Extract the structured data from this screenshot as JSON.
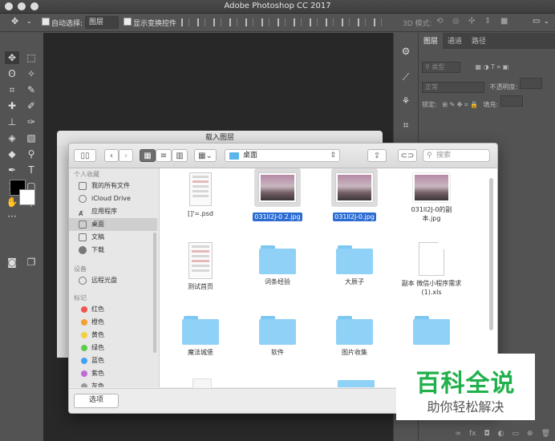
{
  "window": {
    "title": "Adobe Photoshop CC 2017"
  },
  "options_bar": {
    "auto_select_label": "自动选择:",
    "auto_select_value": "图层",
    "show_transform_label": "显示变换控件",
    "mode_3d_label": "3D 模式:"
  },
  "layers_panel": {
    "tabs": [
      "图层",
      "通道",
      "路径"
    ],
    "filter_placeholder": "类型",
    "blend_mode": "正常",
    "opacity_label": "不透明度:",
    "lock_label": "锁定:",
    "fill_label": "填充:"
  },
  "load_layers_window": {
    "title": "载入图层"
  },
  "file_dialog": {
    "location": "桌面",
    "search_placeholder": "搜索",
    "sidebar": {
      "favorites_title": "个人收藏",
      "favorites": [
        "我的所有文件",
        "iCloud Drive",
        "应用程序",
        "桌面",
        "文稿",
        "下载"
      ],
      "devices_title": "设备",
      "devices": [
        "远程光盘"
      ],
      "tags_title": "标记",
      "tags": [
        {
          "label": "红色",
          "color": "#f25450"
        },
        {
          "label": "橙色",
          "color": "#f5a031"
        },
        {
          "label": "黄色",
          "color": "#f4d03e"
        },
        {
          "label": "绿色",
          "color": "#5ccb4d"
        },
        {
          "label": "蓝色",
          "color": "#3fa3f5"
        },
        {
          "label": "紫色",
          "color": "#c06cd8"
        },
        {
          "label": "灰色",
          "color": "#9a9a9a"
        }
      ]
    },
    "files": [
      {
        "label": "[]'=.psd",
        "kind": "psd",
        "selected": false
      },
      {
        "label": "031ll2J-0 2.jpg",
        "kind": "photo",
        "selected": true
      },
      {
        "label": "031ll2J-0.jpg",
        "kind": "photo",
        "selected": true
      },
      {
        "label": "031ll2J-0的副本.jpg",
        "kind": "photo",
        "selected": false
      },
      {
        "label": "测试首页",
        "kind": "image",
        "selected": false
      },
      {
        "label": "词条经验",
        "kind": "folder",
        "selected": false
      },
      {
        "label": "大辰子",
        "kind": "folder",
        "selected": false
      },
      {
        "label": "副本 微信小程序需求(1).xls",
        "kind": "xls",
        "selected": false
      },
      {
        "label": "魔法城堡",
        "kind": "folder",
        "selected": false
      },
      {
        "label": "软件",
        "kind": "folder",
        "selected": false
      },
      {
        "label": "图片收集",
        "kind": "folder",
        "selected": false
      },
      {
        "label": "",
        "kind": "folder",
        "selected": false
      }
    ],
    "options_button": "选项"
  },
  "watermark": {
    "line1": "百科全说",
    "line2": "助你轻松解决",
    "color": "#21b04b"
  }
}
